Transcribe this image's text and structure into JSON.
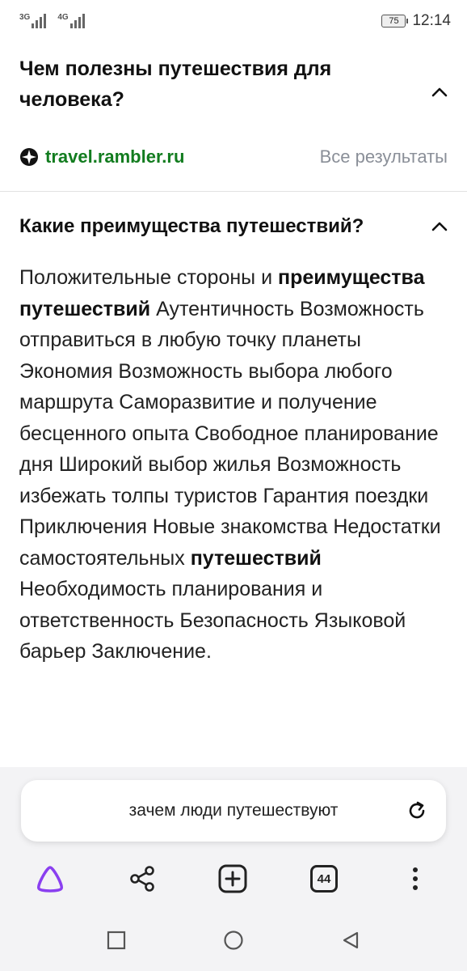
{
  "status_bar": {
    "net1": "3G",
    "net2": "4G",
    "battery": "75",
    "time": "12:14"
  },
  "question1": {
    "title": "Чем полезны путешествия для человека?",
    "expanded_icon": "chevron-up-icon"
  },
  "source": {
    "domain": "travel.rambler.ru",
    "all_results": "Все результаты"
  },
  "question2": {
    "title": "Какие преимущества путешествий?",
    "expanded_icon": "chevron-up-icon"
  },
  "answer": {
    "p1": "Положительные стороны и",
    "b1": "преимущества путешествий",
    "p2": "Аутентичность Возможность отправиться в любую точку планеты Экономия Возможность выбора любого маршрута Саморазвитие и получение бесценного опыта Свободное планирование дня Широкий выбор жилья Возможность избежать толпы туристов Гарантия поездки Приключения Новые знакомства Недостатки самостоятельных",
    "b2": "путешествий",
    "p3": "Необходимость планирования и ответственность Безопасность Языковой барьер Заключение."
  },
  "search": {
    "query": "зачем люди путешествуют",
    "reload_icon": "reload-icon"
  },
  "toolbar": {
    "tabs_count": "44",
    "icons": [
      "alice-icon",
      "share-icon",
      "new-tab-icon",
      "tabs-icon",
      "more-icon"
    ]
  },
  "colors": {
    "link_green": "#127c1f",
    "alice_purple": "#8a3ff0",
    "muted": "#8a8f98"
  }
}
